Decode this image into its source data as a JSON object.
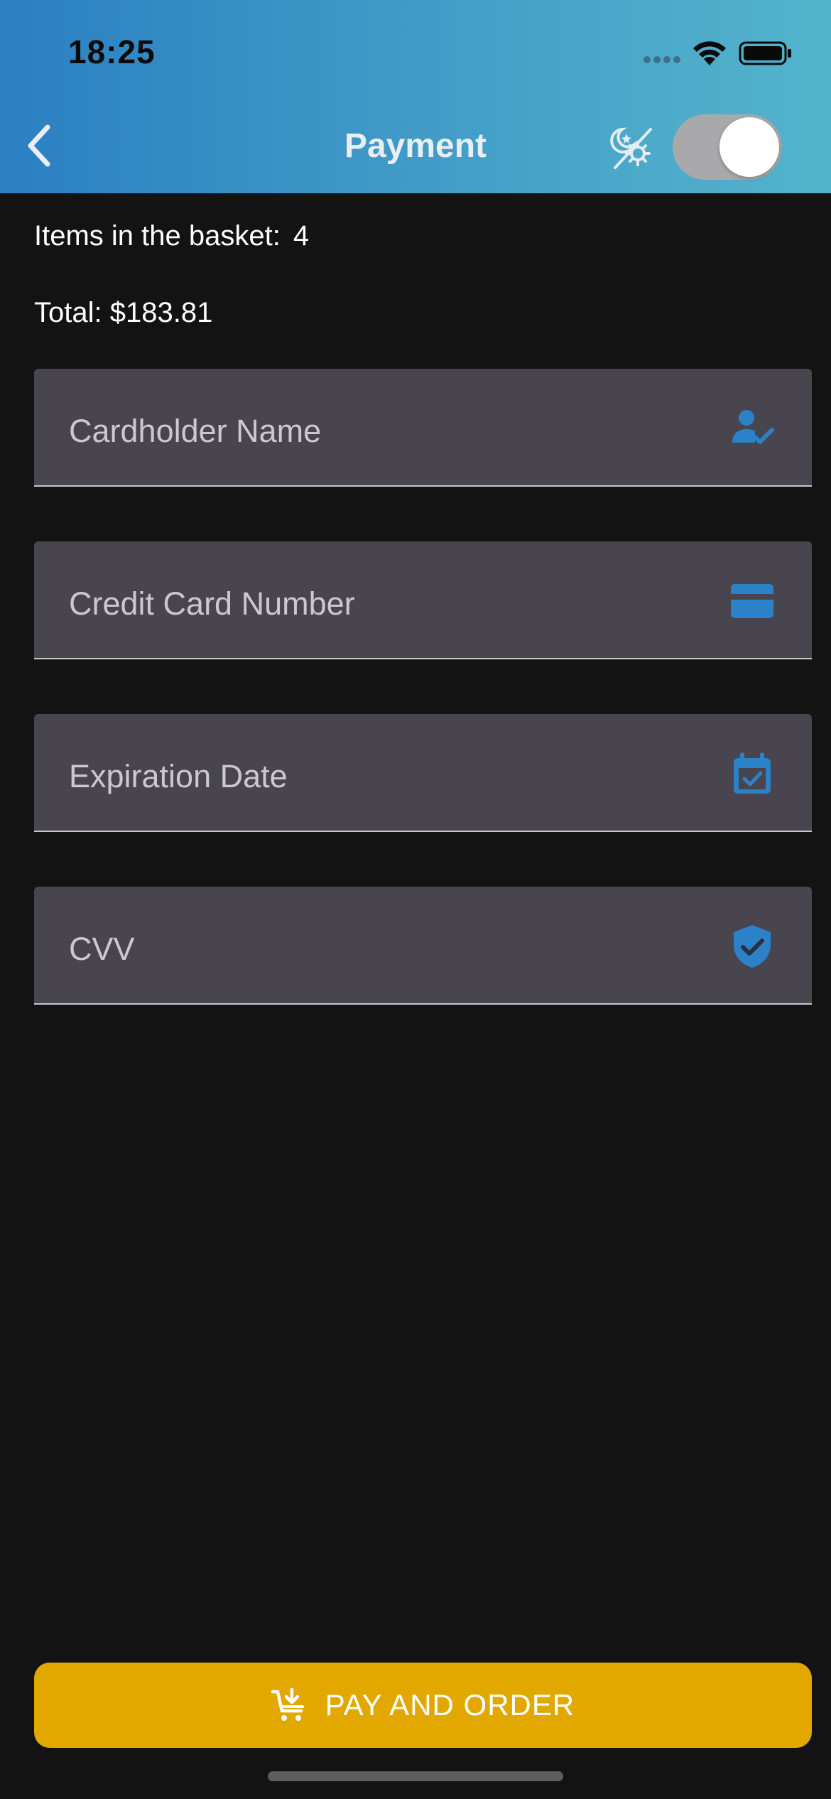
{
  "status_bar": {
    "time": "18:25"
  },
  "header": {
    "title": "Payment",
    "back_icon": "chevron-left-icon",
    "theme_icon": "theme-mode-icon",
    "theme_toggle_on": true
  },
  "summary": {
    "items_label": "Items in the basket:",
    "items_count": "4",
    "total_text": "Total: $183.81"
  },
  "form": {
    "cardholder": {
      "label": "Cardholder Name",
      "icon": "person-check-icon"
    },
    "card_number": {
      "label": "Credit Card Number",
      "icon": "credit-card-icon"
    },
    "expiration": {
      "label": "Expiration Date",
      "icon": "calendar-check-icon"
    },
    "cvv": {
      "label": "CVV",
      "icon": "shield-check-icon"
    }
  },
  "actions": {
    "pay_label": "PAY AND ORDER",
    "pay_icon": "cart-download-icon"
  },
  "colors": {
    "header_gradient_start": "#2b7fc2",
    "header_gradient_end": "#53b3cc",
    "accent_icon": "#2c82c9",
    "field_bg": "#48454f",
    "pay_button": "#e2a800",
    "background": "#131313"
  }
}
